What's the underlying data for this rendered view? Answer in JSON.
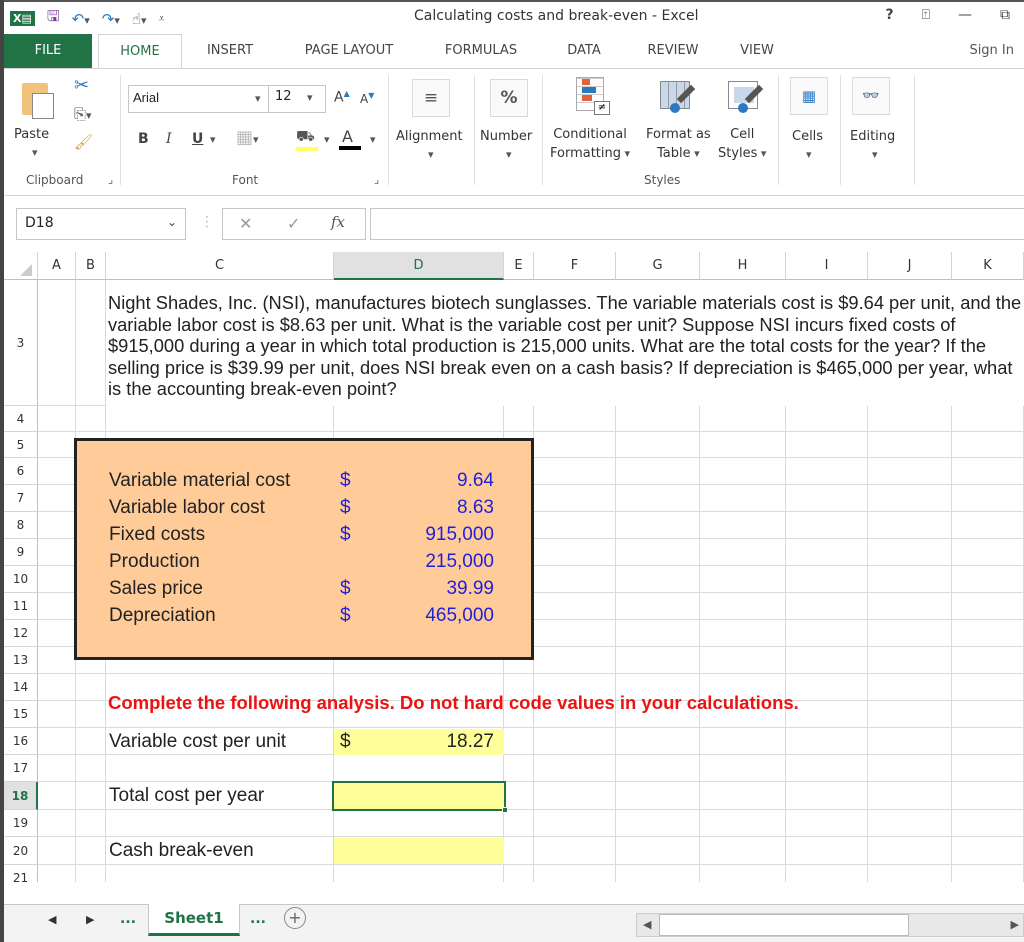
{
  "window": {
    "title": "Calculating costs and break-even - Excel",
    "controls": [
      "help-icon",
      "ribbon-display-icon",
      "minimize-icon",
      "restore-icon"
    ]
  },
  "quick_access": [
    "excel-logo-icon",
    "save-icon",
    "undo-icon",
    "redo-icon",
    "touch-mode-icon",
    "customize-qat-icon"
  ],
  "tabs": [
    {
      "label": "FILE",
      "active": false
    },
    {
      "label": "HOME",
      "active": true
    },
    {
      "label": "INSERT",
      "active": false
    },
    {
      "label": "PAGE LAYOUT",
      "active": false
    },
    {
      "label": "FORMULAS",
      "active": false
    },
    {
      "label": "DATA",
      "active": false
    },
    {
      "label": "REVIEW",
      "active": false
    },
    {
      "label": "VIEW",
      "active": false
    }
  ],
  "sign_in": "Sign In",
  "ribbon": {
    "clipboard": {
      "label": "Clipboard",
      "paste": "Paste"
    },
    "font": {
      "label": "Font",
      "family": "Arial",
      "size": "12",
      "bold": "B",
      "italic": "I",
      "underline": "U",
      "fill_color": "#ffff66",
      "font_color": "#000000"
    },
    "alignment": "Alignment",
    "number": "Number",
    "styles": {
      "label": "Styles",
      "conditional_1": "Conditional",
      "conditional_2": "Formatting",
      "format_table_1": "Format as",
      "format_table_2": "Table",
      "cell_styles_1": "Cell",
      "cell_styles_2": "Styles"
    },
    "cells": "Cells",
    "editing": "Editing"
  },
  "formula_bar": {
    "name_box": "D18",
    "fx": "fx",
    "formula": ""
  },
  "columns": [
    "A",
    "B",
    "C",
    "D",
    "E",
    "F",
    "G",
    "H",
    "I",
    "J",
    "K"
  ],
  "selected_column": "D",
  "rows": [
    "3",
    "4",
    "5",
    "6",
    "7",
    "8",
    "9",
    "10",
    "11",
    "12",
    "13",
    "14",
    "15",
    "16",
    "17",
    "18",
    "19",
    "20",
    "21"
  ],
  "selected_row": "18",
  "sheet": {
    "problem": "Night Shades, Inc. (NSI), manufactures biotech sunglasses. The variable materials cost is $9.64 per unit, and the variable labor cost is $8.63 per unit. What is the variable cost per unit? Suppose NSI incurs fixed costs of $915,000 during a year in which total production is 215,000 units. What are the total costs for the year? If the selling price is $39.99 per unit, does NSI break even on a cash basis? If depreciation is $465,000 per year, what is the accounting break-even point?",
    "inputs": [
      {
        "label": "Variable material cost",
        "currency": "$",
        "value": "9.64"
      },
      {
        "label": "Variable labor cost",
        "currency": "$",
        "value": "8.63"
      },
      {
        "label": "Fixed costs",
        "currency": "$",
        "value": "915,000"
      },
      {
        "label": "Production",
        "currency": "",
        "value": "215,000"
      },
      {
        "label": "Sales price",
        "currency": "$",
        "value": "39.99"
      },
      {
        "label": "Depreciation",
        "currency": "$",
        "value": "465,000"
      }
    ],
    "instruction": "Complete the following analysis. Do not hard code values in your calculations.",
    "outputs": [
      {
        "label": "Variable cost per unit",
        "currency": "$",
        "value": "18.27"
      },
      {
        "label": "Total cost per year",
        "currency": "",
        "value": ""
      },
      {
        "label": "Cash break-even",
        "currency": "",
        "value": ""
      }
    ]
  },
  "sheet_tabs": {
    "active": "Sheet1",
    "ellipsis": "..."
  }
}
